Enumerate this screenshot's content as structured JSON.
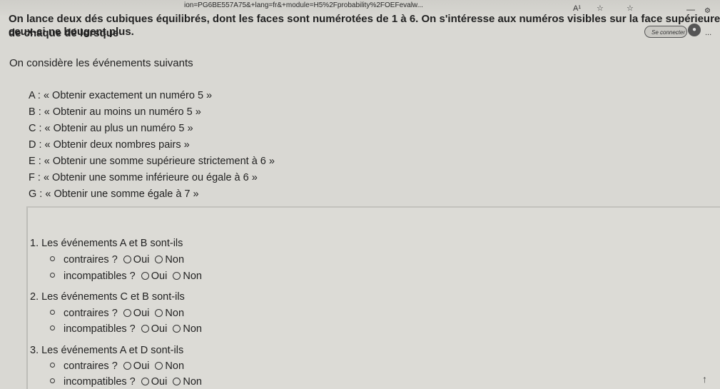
{
  "browser": {
    "url_fragment": "ion=PG6BE557A75&+lang=fr&+module=H5%2Fprobability%2FOEFevalw...",
    "read_aloud_label": "A¹",
    "connect_label": "Se connecter",
    "more_label": "..."
  },
  "exercise": {
    "intro_line1": "On lance deux dés cubiques équilibrés, dont les faces sont numérotées de 1 à 6. On s'intéresse aux numéros visibles sur la face supérieure de chaque dé lorsque",
    "intro_line2": "ceux-ci ne bougent plus.",
    "events_intro": "On considère les événements suivants",
    "events": [
      "A : « Obtenir exactement un numéro 5 »",
      "B : « Obtenir au moins un numéro 5 »",
      "C : « Obtenir au plus un numéro 5 »",
      "D : « Obtenir deux nombres pairs »",
      "E : « Obtenir une somme supérieure strictement à 6 »",
      "F : « Obtenir une somme inférieure ou égale à 6 »",
      "G : « Obtenir une somme égale à 7 »"
    ]
  },
  "questions": [
    {
      "title": "1. Les événements A et B sont-ils",
      "items": [
        {
          "label": "contraires ?",
          "opt_yes": "Oui",
          "opt_no": "Non"
        },
        {
          "label": "incompatibles ?",
          "opt_yes": "Oui",
          "opt_no": "Non"
        }
      ]
    },
    {
      "title": "2. Les événements C et B sont-ils",
      "items": [
        {
          "label": "contraires ?",
          "opt_yes": "Oui",
          "opt_no": "Non"
        },
        {
          "label": "incompatibles ?",
          "opt_yes": "Oui",
          "opt_no": "Non"
        }
      ]
    },
    {
      "title": "3. Les événements A et D sont-ils",
      "items": [
        {
          "label": "contraires ?",
          "opt_yes": "Oui",
          "opt_no": "Non"
        },
        {
          "label": "incompatibles ?",
          "opt_yes": "Oui",
          "opt_no": "Non"
        }
      ]
    }
  ],
  "icons": {
    "minimize": "minimize-icon",
    "settings": "settings-icon",
    "favorite": "star-icon",
    "collections": "collections-icon",
    "profile": "avatar-icon",
    "scroll_up": "arrow-up-icon"
  }
}
